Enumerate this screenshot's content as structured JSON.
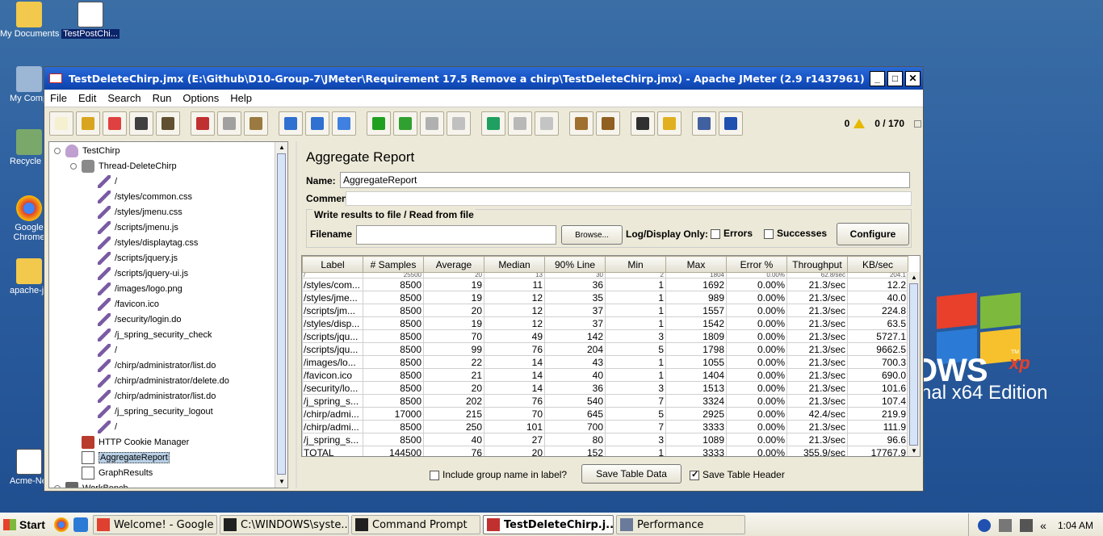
{
  "desktop": {
    "icons": [
      {
        "label": "My Documents"
      },
      {
        "label": "TestPostChi..."
      },
      {
        "label": "My Compu"
      },
      {
        "label": "Recycle B"
      },
      {
        "label": "Google Chrome"
      },
      {
        "label": "apache-jm"
      },
      {
        "label": "Acme-New"
      }
    ],
    "wallpaper": {
      "brand": "OWS",
      "xp": "xp",
      "tm": "TM",
      "edition": "nal x64 Edition"
    }
  },
  "window": {
    "title": "TestDeleteChirp.jmx (E:\\Github\\D10-Group-7\\JMeter\\Requirement 17.5 Remove a chirp\\TestDeleteChirp.jmx) - Apache JMeter (2.9 r1437961)",
    "menu": [
      "File",
      "Edit",
      "Search",
      "Run",
      "Options",
      "Help"
    ],
    "toolbar": {
      "error_count": "0",
      "threads": "0 / 170",
      "buttons": [
        {
          "icon": "new-icon",
          "color": "#f5f0d0"
        },
        {
          "icon": "open-icon",
          "color": "#d9a520"
        },
        {
          "icon": "close-icon",
          "color": "#e04040"
        },
        {
          "icon": "save-icon",
          "color": "#404040"
        },
        {
          "icon": "save-as-icon",
          "color": "#605030"
        },
        {
          "icon": "cut-icon",
          "color": "#c03030"
        },
        {
          "icon": "copy-icon",
          "color": "#a0a0a0"
        },
        {
          "icon": "paste-icon",
          "color": "#9a7a40"
        },
        {
          "icon": "expand-icon",
          "color": "#3070d0"
        },
        {
          "icon": "collapse-icon",
          "color": "#3070d0"
        },
        {
          "icon": "toggle-icon",
          "color": "#4080e0"
        },
        {
          "icon": "start-icon",
          "color": "#20a020"
        },
        {
          "icon": "start-no-pause-icon",
          "color": "#30a030"
        },
        {
          "icon": "stop-icon",
          "color": "#b0b0b0"
        },
        {
          "icon": "shutdown-icon",
          "color": "#c0c0c0"
        },
        {
          "icon": "remote-start-icon",
          "color": "#20a060"
        },
        {
          "icon": "remote-stop-icon",
          "color": "#b8b8b8"
        },
        {
          "icon": "remote-shutdown-icon",
          "color": "#c4c4c4"
        },
        {
          "icon": "clear-icon",
          "color": "#a07030"
        },
        {
          "icon": "clear-all-icon",
          "color": "#906020"
        },
        {
          "icon": "search-icon",
          "color": "#303030"
        },
        {
          "icon": "reset-search-icon",
          "color": "#e0b020"
        },
        {
          "icon": "function-helper-icon",
          "color": "#4060a0"
        },
        {
          "icon": "help-icon",
          "color": "#2050b0"
        }
      ]
    }
  },
  "tree": {
    "items": [
      {
        "label": "TestChirp",
        "type": "plan",
        "level": 0
      },
      {
        "label": "Thread-DeleteChirp",
        "type": "thread",
        "level": 1
      },
      {
        "label": "/",
        "type": "sampler",
        "level": 2
      },
      {
        "label": "/styles/common.css",
        "type": "sampler",
        "level": 2
      },
      {
        "label": "/styles/jmenu.css",
        "type": "sampler",
        "level": 2
      },
      {
        "label": "/scripts/jmenu.js",
        "type": "sampler",
        "level": 2
      },
      {
        "label": "/styles/displaytag.css",
        "type": "sampler",
        "level": 2
      },
      {
        "label": "/scripts/jquery.js",
        "type": "sampler",
        "level": 2
      },
      {
        "label": "/scripts/jquery-ui.js",
        "type": "sampler",
        "level": 2
      },
      {
        "label": "/images/logo.png",
        "type": "sampler",
        "level": 2
      },
      {
        "label": "/favicon.ico",
        "type": "sampler",
        "level": 2
      },
      {
        "label": "/security/login.do",
        "type": "sampler",
        "level": 2
      },
      {
        "label": "/j_spring_security_check",
        "type": "sampler",
        "level": 2
      },
      {
        "label": "/",
        "type": "sampler",
        "level": 2
      },
      {
        "label": "/chirp/administrator/list.do",
        "type": "sampler",
        "level": 2
      },
      {
        "label": "/chirp/administrator/delete.do",
        "type": "sampler",
        "level": 2
      },
      {
        "label": "/chirp/administrator/list.do",
        "type": "sampler",
        "level": 2
      },
      {
        "label": "/j_spring_security_logout",
        "type": "sampler",
        "level": 2
      },
      {
        "label": "/",
        "type": "sampler",
        "level": 2
      },
      {
        "label": "HTTP Cookie Manager",
        "type": "cookie",
        "level": 1
      },
      {
        "label": "AggregateReport",
        "type": "graph",
        "level": 1
      },
      {
        "label": "GraphResults",
        "type": "graph",
        "level": 1
      },
      {
        "label": "WorkBench",
        "type": "bench",
        "level": 0
      }
    ],
    "selected": "AggregateReport"
  },
  "report": {
    "title": "Aggregate Report",
    "name_label": "Name:",
    "name_value": "AggregateReport",
    "comments_label": "Comments:",
    "file_group_title": "Write results to file / Read from file",
    "filename_label": "Filename",
    "browse_label": "Browse...",
    "log_display_label": "Log/Display Only:",
    "errors_label": "Errors",
    "successes_label": "Successes",
    "configure_label": "Configure",
    "include_group_label": "Include group name in label?",
    "save_table_data_label": "Save Table Data",
    "save_table_header_label": "Save Table Header",
    "columns": [
      "Label",
      "# Samples",
      "Average",
      "Median",
      "90% Line",
      "Min",
      "Max",
      "Error %",
      "Throughput",
      "KB/sec"
    ],
    "partial_row": [
      "/",
      "25500",
      "20",
      "13",
      "30",
      "2",
      "1804",
      "0.00%",
      "62.8/sec",
      "204.1"
    ],
    "rows": [
      [
        "/styles/com...",
        "8500",
        "19",
        "11",
        "36",
        "1",
        "1692",
        "0.00%",
        "21.3/sec",
        "12.2"
      ],
      [
        "/styles/jme...",
        "8500",
        "19",
        "12",
        "35",
        "1",
        "989",
        "0.00%",
        "21.3/sec",
        "40.0"
      ],
      [
        "/scripts/jm...",
        "8500",
        "20",
        "12",
        "37",
        "1",
        "1557",
        "0.00%",
        "21.3/sec",
        "224.8"
      ],
      [
        "/styles/disp...",
        "8500",
        "19",
        "12",
        "37",
        "1",
        "1542",
        "0.00%",
        "21.3/sec",
        "63.5"
      ],
      [
        "/scripts/jqu...",
        "8500",
        "70",
        "49",
        "142",
        "3",
        "1809",
        "0.00%",
        "21.3/sec",
        "5727.1"
      ],
      [
        "/scripts/jqu...",
        "8500",
        "99",
        "76",
        "204",
        "5",
        "1798",
        "0.00%",
        "21.3/sec",
        "9662.5"
      ],
      [
        "/images/lo...",
        "8500",
        "22",
        "14",
        "43",
        "1",
        "1055",
        "0.00%",
        "21.3/sec",
        "700.3"
      ],
      [
        "/favicon.ico",
        "8500",
        "21",
        "14",
        "40",
        "1",
        "1404",
        "0.00%",
        "21.3/sec",
        "690.0"
      ],
      [
        "/security/lo...",
        "8500",
        "20",
        "14",
        "36",
        "3",
        "1513",
        "0.00%",
        "21.3/sec",
        "101.6"
      ],
      [
        "/j_spring_s...",
        "8500",
        "202",
        "76",
        "540",
        "7",
        "3324",
        "0.00%",
        "21.3/sec",
        "107.4"
      ],
      [
        "/chirp/admi...",
        "17000",
        "215",
        "70",
        "645",
        "5",
        "2925",
        "0.00%",
        "42.4/sec",
        "219.9"
      ],
      [
        "/chirp/admi...",
        "8500",
        "250",
        "101",
        "700",
        "7",
        "3333",
        "0.00%",
        "21.3/sec",
        "111.9"
      ],
      [
        "/j_spring_s...",
        "8500",
        "40",
        "27",
        "80",
        "3",
        "1089",
        "0.00%",
        "21.3/sec",
        "96.6"
      ],
      [
        "TOTAL",
        "144500",
        "76",
        "20",
        "152",
        "1",
        "3333",
        "0.00%",
        "355.9/sec",
        "17767.9"
      ]
    ]
  },
  "taskbar": {
    "start": "Start",
    "tasks": [
      {
        "label": "Welcome! - Google ...",
        "active": false,
        "color": "#e04030"
      },
      {
        "label": "C:\\WINDOWS\\syste...",
        "active": false,
        "color": "#202020"
      },
      {
        "label": "Command Prompt",
        "active": false,
        "color": "#202020"
      },
      {
        "label": "TestDeleteChirp.j...",
        "active": true,
        "color": "#c03030"
      },
      {
        "label": "Performance",
        "active": false,
        "color": "#6a7a9a"
      }
    ],
    "tray_collapse": "«",
    "clock": "1:04 AM"
  }
}
